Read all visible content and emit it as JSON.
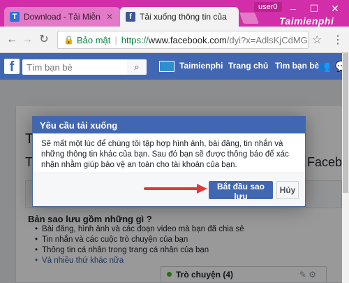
{
  "browser": {
    "tabs": [
      {
        "label": "Download - Tải Miễn P",
        "favicon": "T"
      },
      {
        "label": "Tải xuống thông tin của",
        "favicon": "f"
      }
    ],
    "user_badge": "user0",
    "watermark": "Taimienphi",
    "security_label": "Bảo mật",
    "url_scheme": "https://",
    "url_host": "www.facebook.com",
    "url_path": "/dyi?x=AdlsKjCdMG"
  },
  "fb": {
    "logo": "f",
    "search_placeholder": "Tìm bạn bè",
    "nav": [
      "Taimienphi",
      "Trang chủ",
      "Tìm bạn bè"
    ]
  },
  "page": {
    "title_right_fragment": "Faceb",
    "section_title": "Bản sao lưu gồm những gì ?",
    "bullets": [
      "Bài đăng, hình ảnh và các đoạn video mà bạn đã chia sẻ",
      "Tin nhắn và các cuộc trò chuyện của bạn",
      "Thông tin cá nhân trong trang cá nhân của bạn",
      "Và nhiều thứ khác nữa"
    ],
    "chat_label": "Trò chuyện (4)"
  },
  "dialog": {
    "title": "Yêu cầu tải xuống",
    "body": "Sẽ mất một lúc để chúng tôi tập hợp hình ảnh, bài đăng, tin nhắn và những thông tin khác của bạn. Sau đó bạn sẽ được thông báo để xác nhận nhằm giúp bảo vệ an toàn cho tài khoản của bạn.",
    "primary_button": "Bắt đầu sao lưu",
    "cancel_button": "Hủy"
  },
  "colors": {
    "chrome_titlebar": "#d32ea9",
    "fb_blue": "#4267b2",
    "arrow_red": "#e03a3a"
  }
}
